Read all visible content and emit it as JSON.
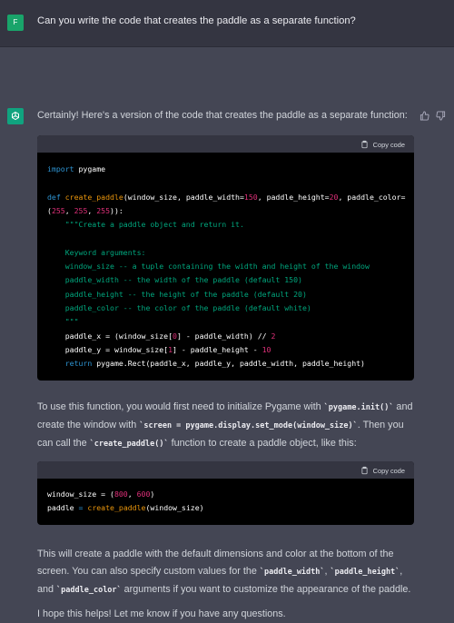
{
  "user_message": {
    "avatar_letter": "F",
    "text": "Can you write the code that creates the paddle as a separate function?"
  },
  "assistant_message": {
    "intro": "Certainly! Here's a version of the code that creates the paddle as a separate function:",
    "copy_label": "Copy code",
    "code_block_1": [
      "import pygame",
      "",
      "def create_paddle(window_size, paddle_width=150, paddle_height=20, paddle_color=",
      "(255, 255, 255)):",
      "    \"\"\"Create a paddle object and return it.",
      "",
      "    Keyword arguments:",
      "    window_size -- a tuple containing the width and height of the window",
      "    paddle_width -- the width of the paddle (default 150)",
      "    paddle_height -- the height of the paddle (default 20)",
      "    paddle_color -- the color of the paddle (default white)",
      "    \"\"\"",
      "    paddle_x = (window_size[0] - paddle_width) // 2",
      "    paddle_y = window_size[1] - paddle_height - 10",
      "    return pygame.Rect(paddle_x, paddle_y, paddle_width, paddle_height)"
    ],
    "para2": {
      "t1": "To use this function, you would first need to initialize Pygame with ",
      "c1": "`pygame.init()`",
      "t2": " and create the window with ",
      "c2": "`screen = pygame.display.set_mode(window_size)`",
      "t3": ". Then you can call the ",
      "c3": "`create_paddle()`",
      "t4": " function to create a paddle object, like this:"
    },
    "code_block_2": [
      "window_size = (800, 600)",
      "paddle = create_paddle(window_size)"
    ],
    "para3": {
      "t1": "This will create a paddle with the default dimensions and color at the bottom of the screen. You can also specify custom values for the ",
      "c1": "`paddle_width`",
      "t2": ", ",
      "c2": "`paddle_height`",
      "t3": ", and ",
      "c3": "`paddle_color`",
      "t4": " arguments if you want to customize the appearance of the paddle."
    },
    "closing": "I hope this helps! Let me know if you have any questions."
  },
  "colors": {
    "background": "#444654",
    "user_row": "#343541",
    "assistant_avatar": "#10a37f",
    "code_bg": "#000000"
  },
  "icons": [
    "openai-logo-icon",
    "thumbs-up-icon",
    "thumbs-down-icon",
    "clipboard-icon"
  ]
}
